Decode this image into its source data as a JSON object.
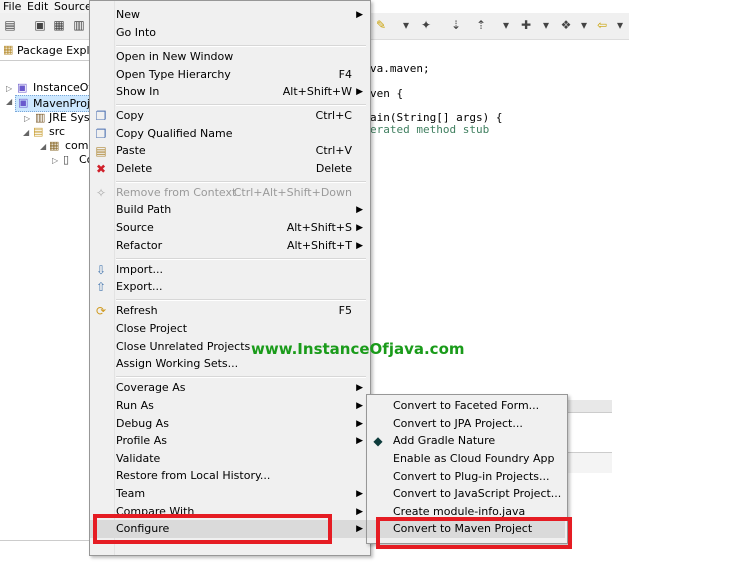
{
  "menubar": {
    "items": [
      "File",
      "Edit",
      "Source"
    ]
  },
  "package_explorer": {
    "title": "Package Explorer",
    "tree": [
      {
        "label": "InstanceOfJav",
        "icon": "project-icon"
      },
      {
        "label": "MavenProjec",
        "icon": "project-icon"
      },
      {
        "label": "JRE Syster",
        "icon": "library-icon"
      },
      {
        "label": "src",
        "icon": "source-folder-icon"
      },
      {
        "label": "com.i",
        "icon": "package-icon"
      },
      {
        "label": "Co",
        "icon": "java-file-icon"
      }
    ]
  },
  "editor": {
    "lines": [
      "va.maven;",
      "ven {",
      "ain(String[] args) {",
      "erated method stub"
    ]
  },
  "context_menu": {
    "items": [
      {
        "label": "New",
        "shortcut": "",
        "submenu": true,
        "icon": ""
      },
      {
        "label": "Go Into",
        "shortcut": "",
        "submenu": false,
        "icon": ""
      },
      {
        "label": "Open in New Window",
        "shortcut": "",
        "submenu": false,
        "icon": ""
      },
      {
        "label": "Open Type Hierarchy",
        "shortcut": "F4",
        "submenu": false,
        "icon": ""
      },
      {
        "label": "Show In",
        "shortcut": "Alt+Shift+W",
        "submenu": true,
        "icon": ""
      },
      {
        "label": "Copy",
        "shortcut": "Ctrl+C",
        "submenu": false,
        "icon": "copy-icon"
      },
      {
        "label": "Copy Qualified Name",
        "shortcut": "",
        "submenu": false,
        "icon": "copy-qualified-icon"
      },
      {
        "label": "Paste",
        "shortcut": "Ctrl+V",
        "submenu": false,
        "icon": "paste-icon"
      },
      {
        "label": "Delete",
        "shortcut": "Delete",
        "submenu": false,
        "icon": "delete-icon"
      },
      {
        "label": "Remove from Context",
        "shortcut": "Ctrl+Alt+Shift+Down",
        "submenu": false,
        "icon": "remove-context-icon",
        "disabled": true
      },
      {
        "label": "Build Path",
        "shortcut": "",
        "submenu": true,
        "icon": ""
      },
      {
        "label": "Source",
        "shortcut": "Alt+Shift+S",
        "submenu": true,
        "icon": ""
      },
      {
        "label": "Refactor",
        "shortcut": "Alt+Shift+T",
        "submenu": true,
        "icon": ""
      },
      {
        "label": "Import...",
        "shortcut": "",
        "submenu": false,
        "icon": "import-icon"
      },
      {
        "label": "Export...",
        "shortcut": "",
        "submenu": false,
        "icon": "export-icon"
      },
      {
        "label": "Refresh",
        "shortcut": "F5",
        "submenu": false,
        "icon": "refresh-icon"
      },
      {
        "label": "Close Project",
        "shortcut": "",
        "submenu": false,
        "icon": ""
      },
      {
        "label": "Close Unrelated Projects",
        "shortcut": "",
        "submenu": false,
        "icon": ""
      },
      {
        "label": "Assign Working Sets...",
        "shortcut": "",
        "submenu": false,
        "icon": ""
      },
      {
        "label": "Coverage As",
        "shortcut": "",
        "submenu": true,
        "icon": ""
      },
      {
        "label": "Run As",
        "shortcut": "",
        "submenu": true,
        "icon": ""
      },
      {
        "label": "Debug As",
        "shortcut": "",
        "submenu": true,
        "icon": ""
      },
      {
        "label": "Profile As",
        "shortcut": "",
        "submenu": true,
        "icon": ""
      },
      {
        "label": "Validate",
        "shortcut": "",
        "submenu": false,
        "icon": ""
      },
      {
        "label": "Restore from Local History...",
        "shortcut": "",
        "submenu": false,
        "icon": ""
      },
      {
        "label": "Team",
        "shortcut": "",
        "submenu": true,
        "icon": ""
      },
      {
        "label": "Compare With",
        "shortcut": "",
        "submenu": true,
        "icon": ""
      },
      {
        "label": "Configure",
        "shortcut": "",
        "submenu": true,
        "icon": "",
        "highlighted": true
      }
    ]
  },
  "configure_submenu": {
    "items": [
      {
        "label": "Convert to Faceted Form...",
        "icon": ""
      },
      {
        "label": "Convert to JPA Project...",
        "icon": ""
      },
      {
        "label": "Add Gradle Nature",
        "icon": "gradle-icon"
      },
      {
        "label": "Enable as Cloud Foundry App",
        "icon": ""
      },
      {
        "label": "Convert to Plug-in Projects...",
        "icon": ""
      },
      {
        "label": "Convert to JavaScript Project...",
        "icon": ""
      },
      {
        "label": "Create module-info.java",
        "icon": ""
      },
      {
        "label": "Convert to Maven Project",
        "icon": "",
        "highlighted": true
      }
    ]
  },
  "watermark": "www.InstanceOfjava.com",
  "colors": {
    "highlight_box": "#e51c23",
    "watermark": "#1a9b1a",
    "menu_bg": "#f0f0f0"
  }
}
